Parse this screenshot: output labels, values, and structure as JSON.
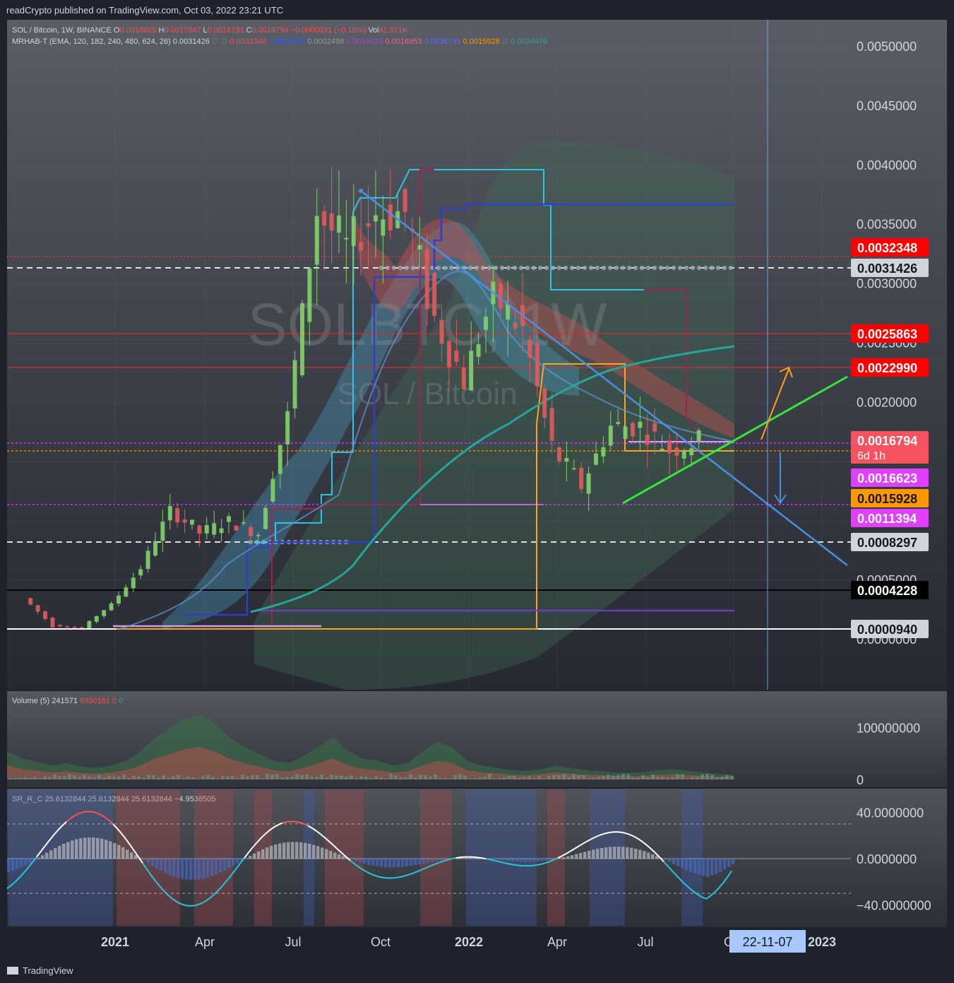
{
  "header": {
    "published": "readCrypto published on TradingView.com, Oct 03, 2022 23:21 UTC"
  },
  "legend": {
    "symbol": "SOL / Bitcoin, 1W, BINANCE",
    "ohlc": [
      {
        "k": "O",
        "v": "0.0016825",
        "c": "#ef5350"
      },
      {
        "k": "H",
        "v": "0.0017047",
        "c": "#ef5350"
      },
      {
        "k": "L",
        "v": "0.0016731",
        "c": "#ef5350"
      },
      {
        "k": "C",
        "v": "0.0016794",
        "c": "#ef5350"
      },
      {
        "k": "",
        "v": "−0.0000031 (−0.18%)",
        "c": "#ef5350"
      },
      {
        "k": "Vol",
        "v": "41.571K",
        "c": "#ef5350"
      }
    ],
    "indicator": "MRHAB-T (EMA, 120, 182, 240, 480, 624, 26)",
    "ind_values": [
      {
        "v": "0.0031426",
        "c": "#d1d4dc"
      },
      {
        "v": "∅",
        "c": "#787b86"
      },
      {
        "v": "∅",
        "c": "#787b86"
      },
      {
        "v": "0.0032348",
        "c": "#ef5350"
      },
      {
        "v": "0.0016623",
        "c": "#2962ff"
      },
      {
        "v": "0.0002498",
        "c": "#9598a1"
      },
      {
        "v": "0.0016623",
        "c": "#ab47bc"
      },
      {
        "v": "0.0016953",
        "c": "#f06292"
      },
      {
        "v": "0.0036745",
        "c": "#5b6cff"
      },
      {
        "v": "0.0015928",
        "c": "#ff9800"
      },
      {
        "v": "∅",
        "c": "#787b86"
      },
      {
        "v": "0.0024676",
        "c": "#26a69a"
      }
    ]
  },
  "watermark": {
    "symbol": "SOLBTC, 1W",
    "name": "SOL / Bitcoin"
  },
  "price_axis": {
    "ticks": [
      "0.0050000",
      "0.0045000",
      "0.0040000",
      "0.0035000",
      "0.0030000",
      "0.0025000",
      "0.0020000",
      "0.0005000",
      "0.0000000"
    ]
  },
  "price_labels": [
    {
      "text": "0.0032348",
      "bg": "#ff0000",
      "fg": "#ffffff"
    },
    {
      "text": "0.0031426",
      "bg": "#d1d4dc",
      "fg": "#131722"
    },
    {
      "text": "0.0025863",
      "bg": "#ff0000",
      "fg": "#ffffff"
    },
    {
      "text": "0.0022990",
      "bg": "#ff0000",
      "fg": "#ffffff"
    },
    {
      "text": "0.0016794",
      "sub": "6d 1h",
      "bg": "#f7525f",
      "fg": "#ffffff"
    },
    {
      "text": "0.0016623",
      "bg": "#e040fb",
      "fg": "#ffffff"
    },
    {
      "text": "0.0015928",
      "bg": "#ff9800",
      "fg": "#131722"
    },
    {
      "text": "0.0011394",
      "bg": "#e040fb",
      "fg": "#ffffff"
    },
    {
      "text": "0.0008297",
      "bg": "#d1d4dc",
      "fg": "#131722"
    },
    {
      "text": "0.0004228",
      "bg": "#000000",
      "fg": "#ffffff"
    },
    {
      "text": "0.0000940",
      "bg": "#d1d4dc",
      "fg": "#131722"
    }
  ],
  "volume_pane": {
    "title": "Volume (5)",
    "v1": "241571",
    "v2": "9350181",
    "v3": "0",
    "v4": "0",
    "ticks": [
      "100000000",
      "0"
    ]
  },
  "osc_pane": {
    "title": "SR_R_C",
    "values": [
      "25.6132844",
      "25.6132844",
      "25.6132844",
      "−4.9538505"
    ],
    "ticks": [
      "40.0000000",
      "0.0000000",
      "−40.0000000"
    ]
  },
  "time_axis": {
    "labels": [
      "2021",
      "Apr",
      "Jul",
      "Oct",
      "2022",
      "Apr",
      "Jul",
      "O",
      "2023"
    ],
    "cursor_label": "22-11-07"
  },
  "footer": {
    "brand": "TradingView"
  },
  "chart_data": {
    "type": "candlestick",
    "title": "SOL / Bitcoin, 1W, BINANCE",
    "x_range": [
      "2020-10",
      "2023-01"
    ],
    "y_range": [
      0.0,
      0.0052
    ],
    "price_path": [
      {
        "t": "2020-11",
        "p": 0.00035
      },
      {
        "t": "2020-12",
        "p": 0.00012
      },
      {
        "t": "2021-01",
        "p": 0.0001
      },
      {
        "t": "2021-02",
        "p": 0.0003
      },
      {
        "t": "2021-03",
        "p": 0.0006
      },
      {
        "t": "2021-04",
        "p": 0.0011
      },
      {
        "t": "2021-05",
        "p": 0.0009
      },
      {
        "t": "2021-06",
        "p": 0.001
      },
      {
        "t": "2021-07",
        "p": 0.0009
      },
      {
        "t": "2021-08",
        "p": 0.0019
      },
      {
        "t": "2021-09",
        "p": 0.0036
      },
      {
        "t": "2021-10",
        "p": 0.0033
      },
      {
        "t": "2021-11",
        "p": 0.0036
      },
      {
        "t": "2021-12",
        "p": 0.0036
      },
      {
        "t": "2022-01",
        "p": 0.0027
      },
      {
        "t": "2022-02",
        "p": 0.0022
      },
      {
        "t": "2022-03",
        "p": 0.0029
      },
      {
        "t": "2022-04",
        "p": 0.0026
      },
      {
        "t": "2022-05",
        "p": 0.0016
      },
      {
        "t": "2022-06",
        "p": 0.0013
      },
      {
        "t": "2022-07",
        "p": 0.0018
      },
      {
        "t": "2022-08",
        "p": 0.0018
      },
      {
        "t": "2022-09",
        "p": 0.0016
      },
      {
        "t": "2022-10",
        "p": 0.0016794
      }
    ],
    "horizontal_levels": [
      0.0032348,
      0.0031426,
      0.0025863,
      0.002299,
      0.0016623,
      0.0015928,
      0.0011394,
      0.0008297,
      0.0004228,
      9.4e-05
    ],
    "volume_axis_range": [
      0,
      150000000
    ],
    "oscillator_axis_range": [
      -55,
      55
    ]
  }
}
